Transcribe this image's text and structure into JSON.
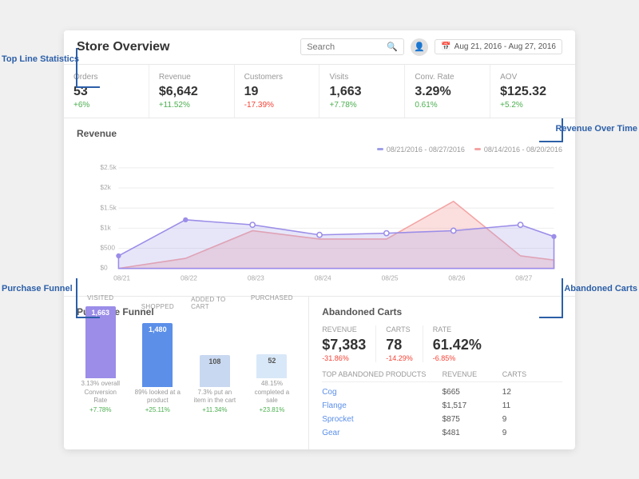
{
  "header": {
    "title": "Store Overview",
    "search_placeholder": "Search",
    "date_range": "Aug 21, 2016 - Aug 27, 2016"
  },
  "stats": [
    {
      "label": "Orders",
      "value": "53",
      "change": "+6%",
      "positive": true
    },
    {
      "label": "Revenue",
      "value": "$6,642",
      "change": "+11.52%",
      "positive": true
    },
    {
      "label": "Customers",
      "value": "19",
      "change": "-17.39%",
      "positive": false
    },
    {
      "label": "Visits",
      "value": "1,663",
      "change": "+7.78%",
      "positive": true
    },
    {
      "label": "Conv. Rate",
      "value": "3.29%",
      "change": "0.61%",
      "positive": true
    },
    {
      "label": "AOV",
      "value": "$125.32",
      "change": "+5.2%",
      "positive": true
    }
  ],
  "chart": {
    "title": "Revenue",
    "legend": [
      {
        "label": "08/21/2016 - 08/27/2016",
        "color": "#9e9de8"
      },
      {
        "label": "08/14/2016 - 08/20/2016",
        "color": "#f4a4a4"
      }
    ],
    "x_labels": [
      "08/21",
      "08/22",
      "08/23",
      "08/24",
      "08/25",
      "08/26",
      "08/27"
    ],
    "y_labels": [
      "$2.5k",
      "$2k",
      "$1.5k",
      "$1k",
      "$500",
      "$0"
    ]
  },
  "funnel": {
    "title": "Purchase Funnel",
    "columns": [
      "VISITED",
      "SHOPPED",
      "ADDED TO CART",
      "PURCHASED"
    ],
    "bars": [
      {
        "value": "1,663",
        "desc": "3.13% overall Conversion Rate",
        "change": "+7.78%"
      },
      {
        "value": "1,480",
        "desc": "89% looked at a product",
        "change": "+25.11%"
      },
      {
        "value": "108",
        "desc": "7.3% put an item in the cart",
        "change": "+11.34%"
      },
      {
        "value": "52",
        "desc": "48.15% completed a sale",
        "change": "+23.81%"
      }
    ]
  },
  "abandoned_carts": {
    "title": "Abandoned Carts",
    "metrics": [
      {
        "label": "REVENUE",
        "value": "$7,383",
        "change": "-31.86%",
        "positive": false
      },
      {
        "label": "CARTS",
        "value": "78",
        "change": "-14.29%",
        "positive": false
      },
      {
        "label": "RATE",
        "value": "61.42%",
        "change": "-6.85%",
        "positive": false
      }
    ],
    "table_headers": [
      "TOP ABANDONED PRODUCTS",
      "REVENUE",
      "CARTS"
    ],
    "rows": [
      {
        "product": "Cog",
        "revenue": "$665",
        "carts": "12"
      },
      {
        "product": "Flange",
        "revenue": "$1,517",
        "carts": "11"
      },
      {
        "product": "Sprocket",
        "revenue": "$875",
        "carts": "9"
      },
      {
        "product": "Gear",
        "revenue": "$481",
        "carts": "9"
      }
    ]
  },
  "annotations": {
    "top_line": "Top Line Statistics",
    "revenue_over_time": "Revenue Over Time",
    "purchase_funnel": "Purchase Funnel",
    "abandoned_carts": "Abandoned Carts"
  }
}
